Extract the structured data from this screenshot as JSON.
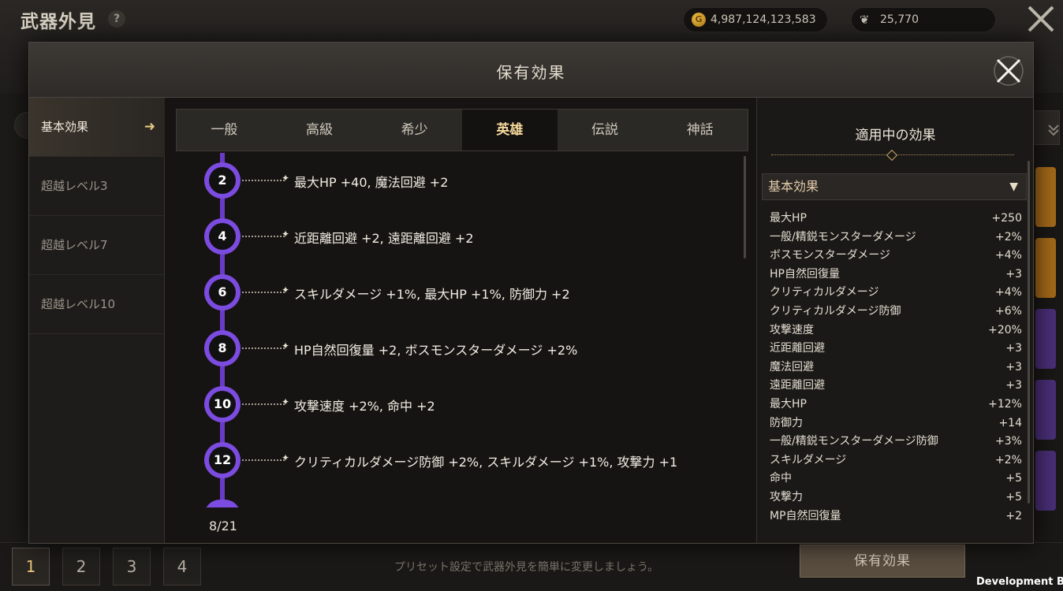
{
  "page": {
    "title": "武器外見",
    "help": "?",
    "gold": "4,987,124,123,583",
    "feather": "25,770"
  },
  "presets": [
    "1",
    "2",
    "3",
    "4"
  ],
  "preset_hint": "プリセット設定で武器外見を簡単に変更しましょう。",
  "holding_button": "保有効果",
  "dev_build": "Development Build",
  "modal": {
    "title": "保有効果",
    "nav": [
      "基本効果",
      "超越レベル3",
      "超越レベル7",
      "超越レベル10"
    ],
    "tabs": [
      "一般",
      "高級",
      "希少",
      "英雄",
      "伝説",
      "神話"
    ],
    "active_tab": "英雄",
    "milestones": [
      {
        "level": "2",
        "text": "最大HP +40, 魔法回避 +2"
      },
      {
        "level": "4",
        "text": "近距離回避 +2, 遠距離回避 +2"
      },
      {
        "level": "6",
        "text": "スキルダメージ +1%, 最大HP +1%, 防御力 +2"
      },
      {
        "level": "8",
        "text": "HP自然回復量 +2, ボスモンスターダメージ +2%"
      },
      {
        "level": "10",
        "text": "攻撃速度 +2%, 命中 +2"
      },
      {
        "level": "12",
        "text": "クリティカルダメージ防御 +2%, スキルダメージ +1%, 攻撃力 +1"
      }
    ],
    "progress": "8/21",
    "applied_title": "適用中の効果",
    "section": "基本効果",
    "effects": [
      {
        "name": "最大HP",
        "value": "+250"
      },
      {
        "name": "一般/精鋭モンスターダメージ",
        "value": "+2%"
      },
      {
        "name": "ボスモンスターダメージ",
        "value": "+4%"
      },
      {
        "name": "HP自然回復量",
        "value": "+3"
      },
      {
        "name": "クリティカルダメージ",
        "value": "+4%"
      },
      {
        "name": "クリティカルダメージ防御",
        "value": "+6%"
      },
      {
        "name": "攻撃速度",
        "value": "+20%"
      },
      {
        "name": "近距離回避",
        "value": "+3"
      },
      {
        "name": "魔法回避",
        "value": "+3"
      },
      {
        "name": "遠距離回避",
        "value": "+3"
      },
      {
        "name": "最大HP",
        "value": "+12%"
      },
      {
        "name": "防御力",
        "value": "+14"
      },
      {
        "name": "一般/精鋭モンスターダメージ防御",
        "value": "+3%"
      },
      {
        "name": "スキルダメージ",
        "value": "+2%"
      },
      {
        "name": "命中",
        "value": "+5"
      },
      {
        "name": "攻撃力",
        "value": "+5"
      },
      {
        "name": "MP自然回復量",
        "value": "+2"
      }
    ]
  },
  "colors": {
    "accent_purple": "#7c4be0",
    "active_tab_text": "#f4d79a",
    "nav_arrow": "#e7c983"
  }
}
